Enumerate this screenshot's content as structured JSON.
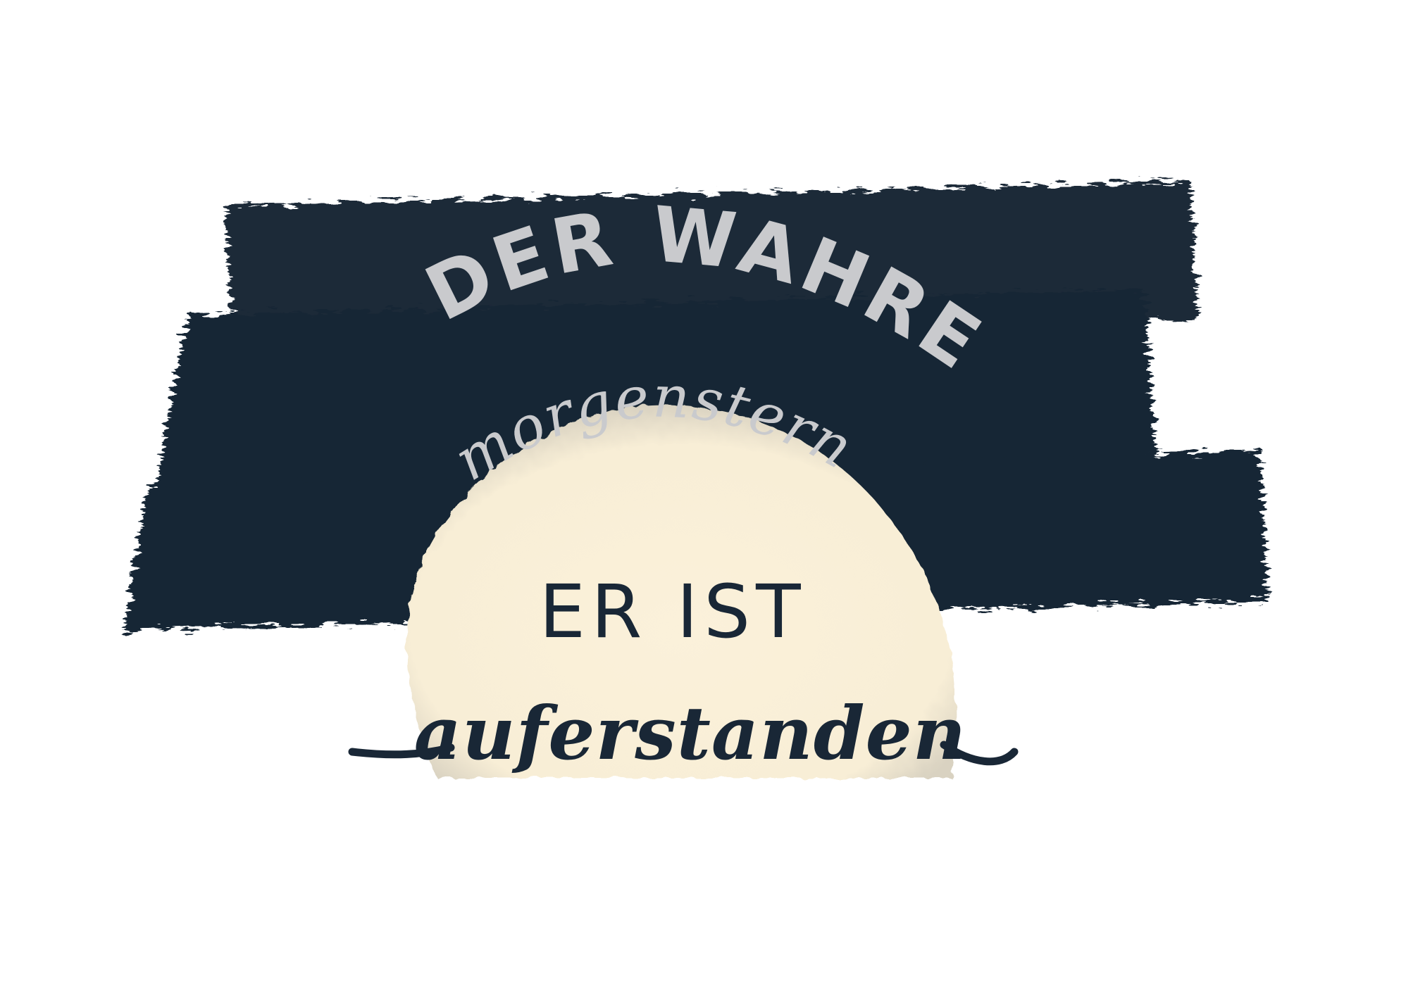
{
  "headline": {
    "line1": "DER WAHRE",
    "line2": "morgenstern",
    "line3": "ER IST",
    "line4": "auferstanden"
  },
  "colors": {
    "background": "#ffffff",
    "brush_navy": "#192736",
    "sun_cream": "#fbf1da",
    "arc_text_grey": "#c9cacd",
    "dark_text": "#192736"
  }
}
